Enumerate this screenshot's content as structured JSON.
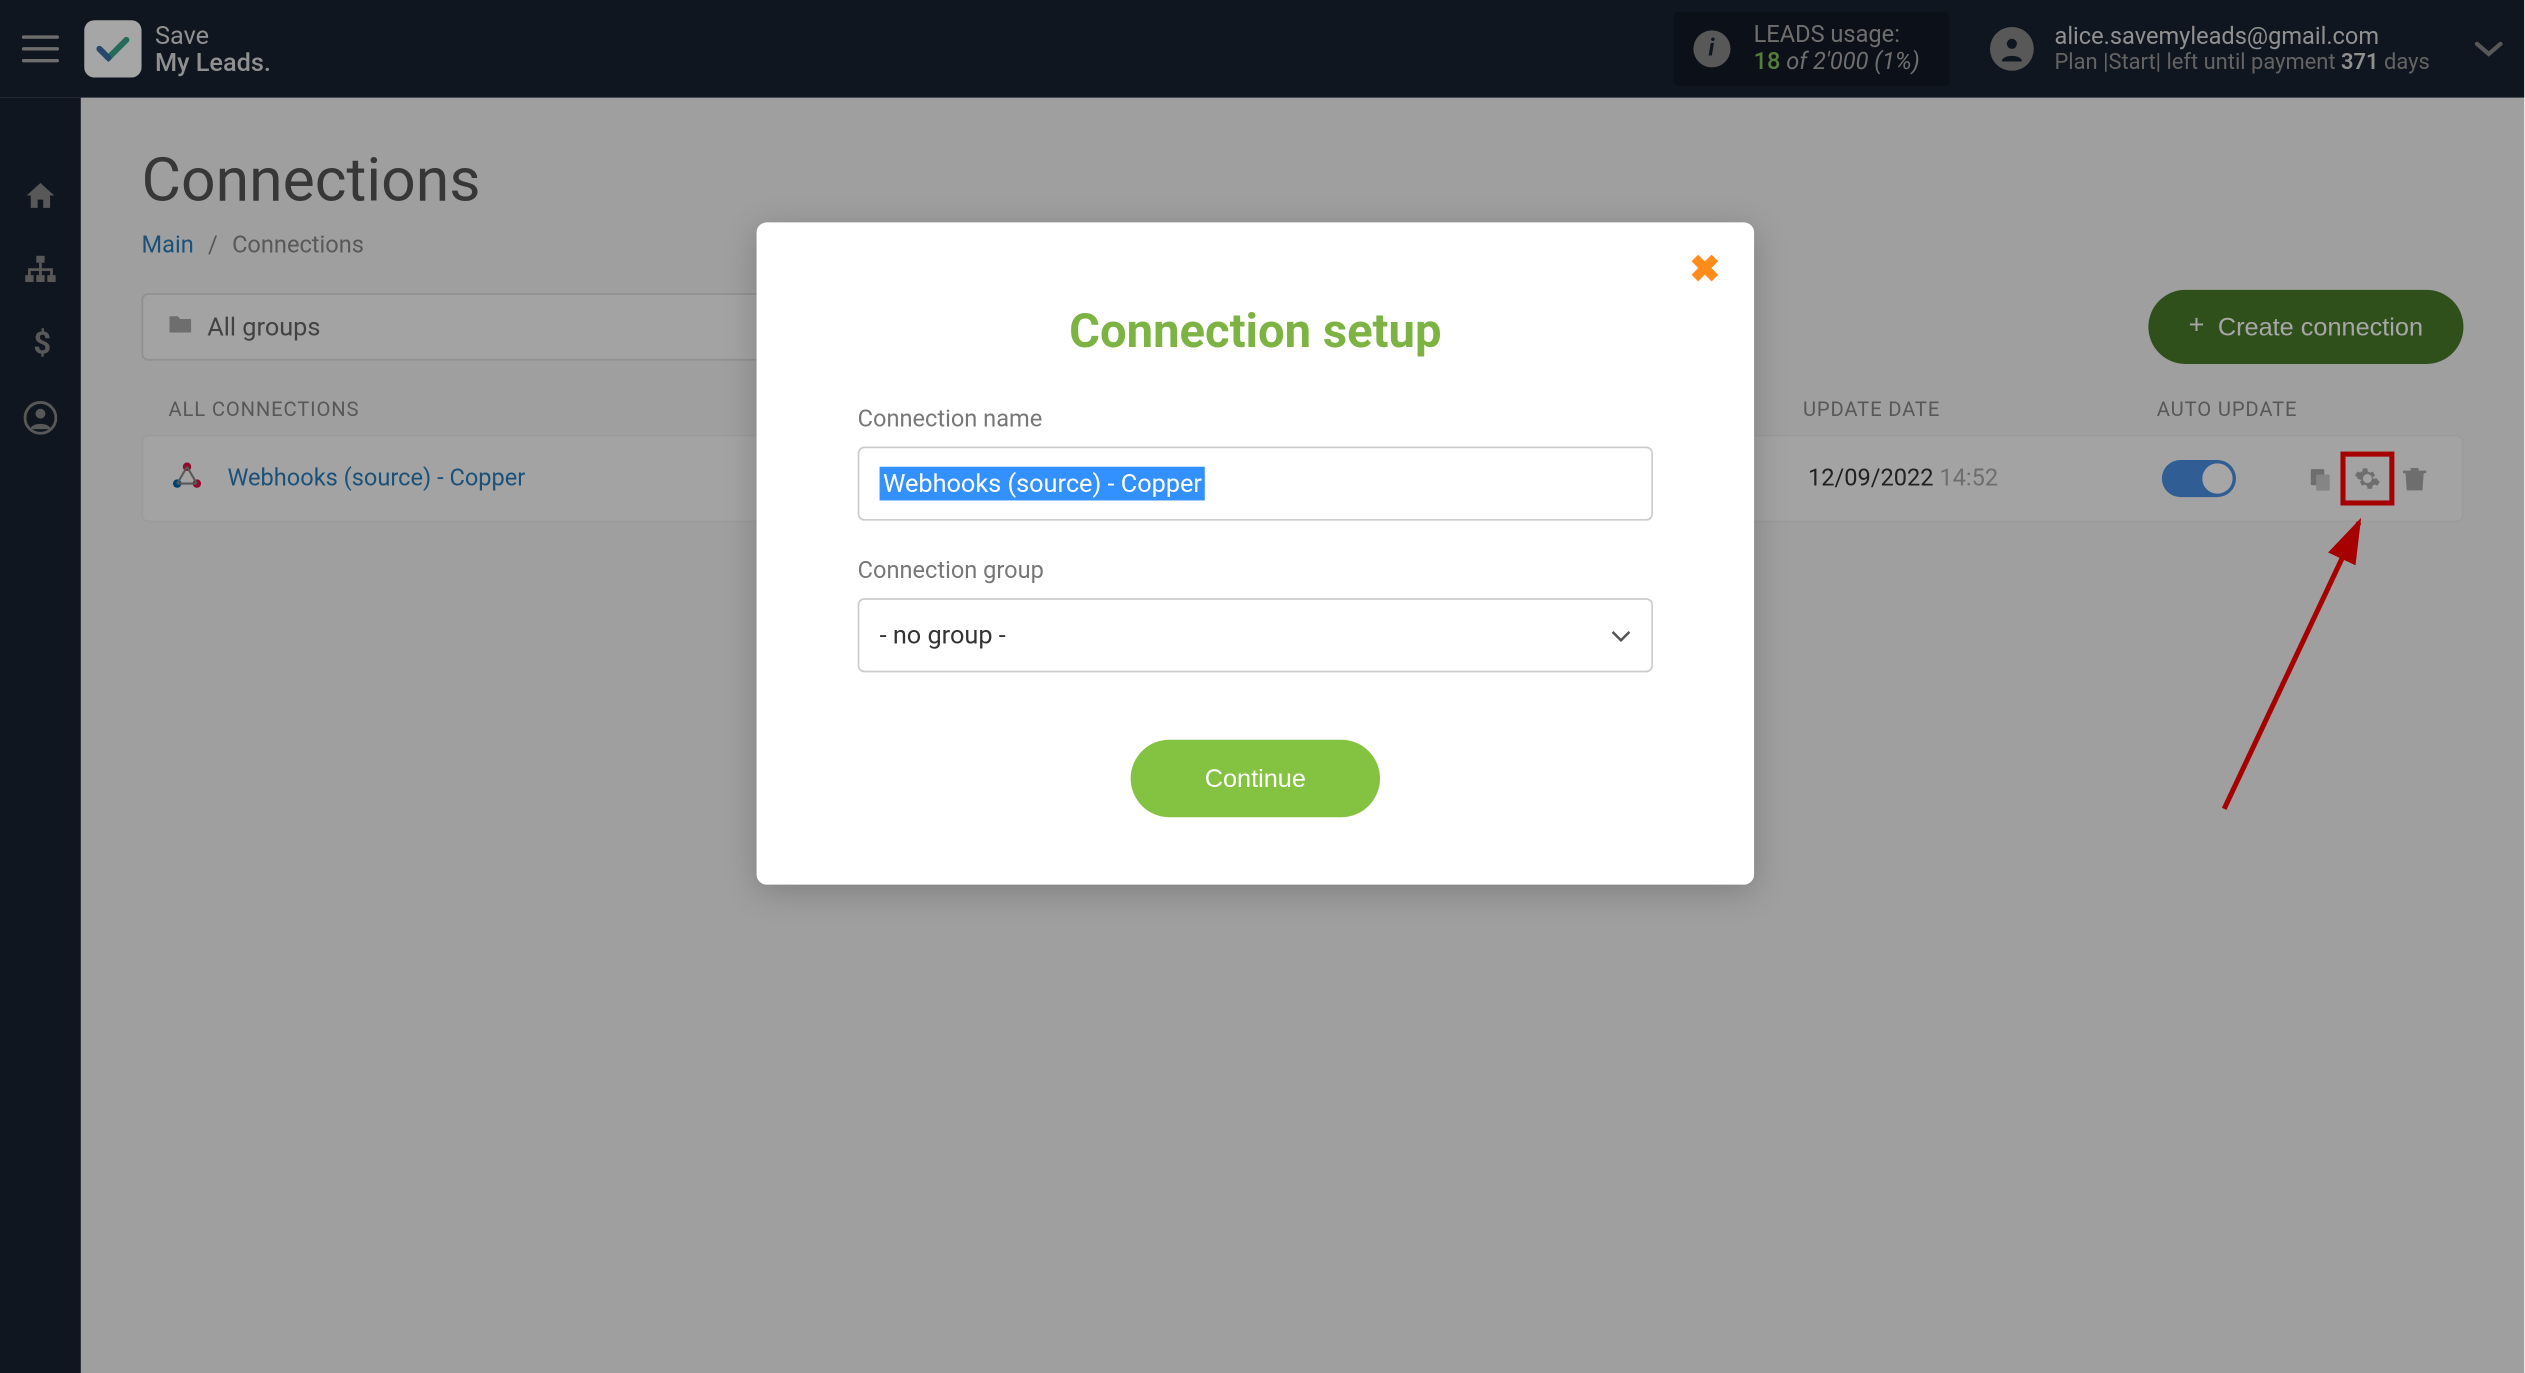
{
  "header": {
    "logo_line1": "Save",
    "logo_line2": "My Leads.",
    "usage_label": "LEADS usage:",
    "usage_value": "18",
    "usage_of": " of ",
    "usage_total": "2'000",
    "usage_percent": " (1%)",
    "user_email": "alice.savemyleads@gmail.com",
    "plan_prefix": "Plan ",
    "plan_name": "|Start|",
    "plan_mid": " left until payment ",
    "plan_days": "371",
    "plan_suffix": " days"
  },
  "page": {
    "title": "Connections",
    "breadcrumb_main": "Main",
    "breadcrumb_current": "Connections",
    "group_filter": "All groups",
    "create_button": "Create connection"
  },
  "columns": {
    "name": "ALL CONNECTIONS",
    "date": "UPDATE DATE",
    "auto": "AUTO UPDATE"
  },
  "row": {
    "name": "Webhooks (source) - Copper",
    "date": "12/09/2022",
    "time": "14:52"
  },
  "modal": {
    "title": "Connection setup",
    "name_label": "Connection name",
    "name_value": "Webhooks (source) - Copper",
    "group_label": "Connection group",
    "group_value": "- no group -",
    "continue": "Continue"
  }
}
